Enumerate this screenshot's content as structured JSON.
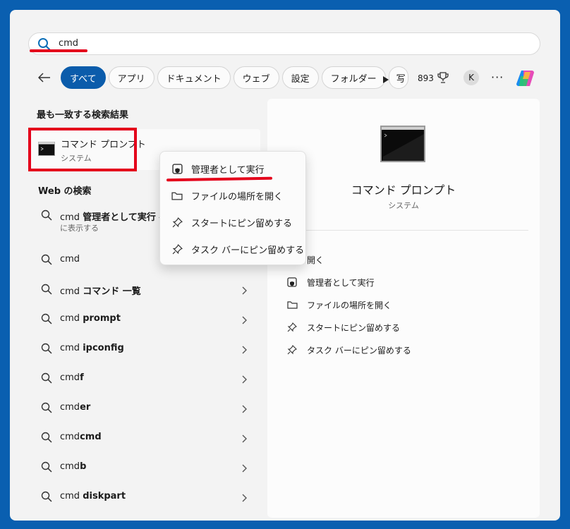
{
  "search": {
    "value": "cmd",
    "icon": "search-icon"
  },
  "filters": {
    "back_icon": "arrow-left-icon",
    "chips": [
      {
        "label": "すべて",
        "active": true
      },
      {
        "label": "アプリ"
      },
      {
        "label": "ドキュメント"
      },
      {
        "label": "ウェブ"
      },
      {
        "label": "設定"
      },
      {
        "label": "フォルダー"
      },
      {
        "label": "写"
      }
    ],
    "points": "893",
    "avatar": "K",
    "more": "···"
  },
  "best_match": {
    "heading": "最も一致する検索結果",
    "title": "コマンド プロンプト",
    "subtitle": "システム"
  },
  "web": {
    "heading": "Web の検索",
    "items": [
      {
        "prefix": "cmd ",
        "bold": "管理者として実行",
        "suffix": " -",
        "sub": "に表示する"
      },
      {
        "prefix": "cmd",
        "bold": "",
        "suffix": ""
      },
      {
        "prefix": "cmd ",
        "bold": "コマンド 一覧",
        "suffix": ""
      },
      {
        "prefix": "cmd ",
        "bold": "prompt",
        "suffix": ""
      },
      {
        "prefix": "cmd ",
        "bold": "ipconfig",
        "suffix": ""
      },
      {
        "prefix": "cmd",
        "bold": "f",
        "suffix": ""
      },
      {
        "prefix": "cmd",
        "bold": "er",
        "suffix": ""
      },
      {
        "prefix": "cmd",
        "bold": "cmd",
        "suffix": ""
      },
      {
        "prefix": "cmd",
        "bold": "b",
        "suffix": ""
      },
      {
        "prefix": "cmd ",
        "bold": "diskpart",
        "suffix": ""
      }
    ]
  },
  "context_menu": {
    "items": [
      {
        "label": "管理者として実行",
        "icon": "shield-window-icon"
      },
      {
        "label": "ファイルの場所を開く",
        "icon": "folder-icon"
      },
      {
        "label": "スタートにピン留めする",
        "icon": "pin-icon"
      },
      {
        "label": "タスク バーにピン留めする",
        "icon": "pin-icon"
      }
    ]
  },
  "detail": {
    "title": "コマンド プロンプト",
    "subtitle": "システム",
    "actions": [
      {
        "label": "開く",
        "icon": "open-icon"
      },
      {
        "label": "管理者として実行",
        "icon": "shield-window-icon"
      },
      {
        "label": "ファイルの場所を開く",
        "icon": "folder-icon"
      },
      {
        "label": "スタートにピン留めする",
        "icon": "pin-icon"
      },
      {
        "label": "タスク バーにピン留めする",
        "icon": "pin-icon"
      }
    ]
  },
  "colors": {
    "accent": "#0b5cab",
    "highlight": "#e4001b",
    "frame": "#0a5fb0"
  }
}
